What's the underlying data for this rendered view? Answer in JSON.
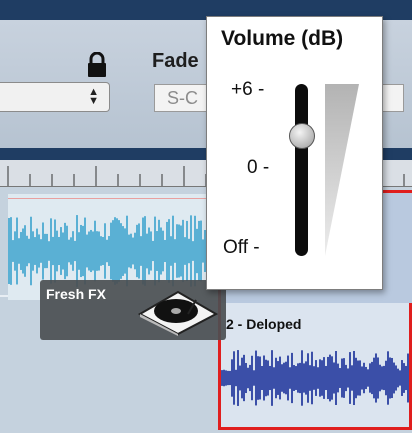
{
  "header": {
    "fade_label": "Fade",
    "fade_value": "S-C"
  },
  "clips": {
    "fx_label": "Fresh FX",
    "clip2_title": "2 - Deloped"
  },
  "volume_popup": {
    "title": "Volume (dB)",
    "tick_top": "+6 -",
    "tick_mid": "0 -",
    "tick_bottom": "Off -",
    "value_db": "0"
  },
  "colors": {
    "clip_selection": "#e01e1e",
    "waveform_light": "#5ab0d4",
    "waveform_dark": "#3b4fa8"
  }
}
